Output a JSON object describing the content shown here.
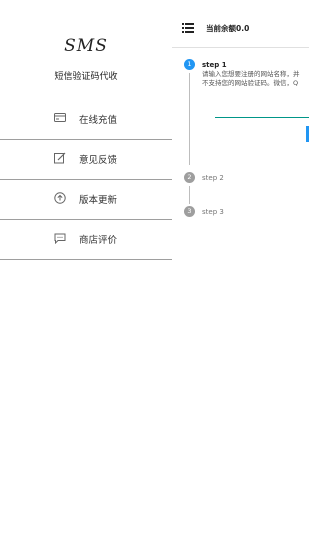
{
  "drawer": {
    "logo": "SMS",
    "title": "短信验证码代收",
    "items": [
      {
        "label": "在线充值",
        "icon": "card-icon"
      },
      {
        "label": "意见反馈",
        "icon": "edit-icon"
      },
      {
        "label": "版本更新",
        "icon": "upload-circle-icon"
      },
      {
        "label": "商店评价",
        "icon": "chat-icon"
      }
    ]
  },
  "header": {
    "balance": "当前余额0.0"
  },
  "steps": [
    {
      "number": "1",
      "title": "step 1",
      "active": true
    },
    {
      "number": "2",
      "title": "step 2",
      "active": false
    },
    {
      "number": "3",
      "title": "step 3",
      "active": false
    }
  ],
  "step1_desc": {
    "line1": "请输入您想要注册的网站名称，并",
    "line2": "不支持您的网站验证码。微信，Q"
  },
  "colors": {
    "accent": "#2196f3",
    "inactive_step": "#9e9e9e",
    "input_underline": "#009688"
  }
}
